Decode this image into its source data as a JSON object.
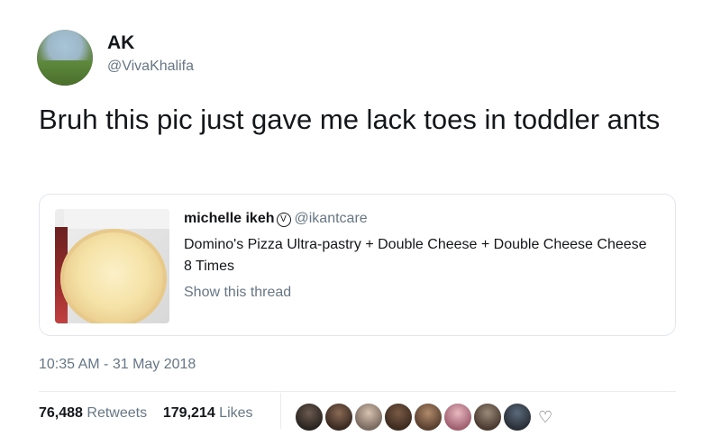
{
  "tweet": {
    "display_name": "AK",
    "handle": "@VivaKhalifa",
    "text": "Bruh this pic just gave me lack toes in toddler ants",
    "timestamp": "10:35 AM - 31 May 2018"
  },
  "quote": {
    "author_name": "michelle ikeh",
    "verified_glyph": "V",
    "author_handle": "@ikantcare",
    "text": "Domino's Pizza Ultra-pastry + Double Cheese + Double Cheese Cheese 8 Times",
    "show_thread": "Show this thread"
  },
  "stats": {
    "retweets_count": "76,488",
    "retweets_label": "Retweets",
    "likes_count": "179,214",
    "likes_label": "Likes"
  },
  "likers": {
    "more_glyph": "♡"
  },
  "colors": {
    "text_primary": "#14171a",
    "text_secondary": "#657786",
    "border": "#e1e8ed"
  }
}
